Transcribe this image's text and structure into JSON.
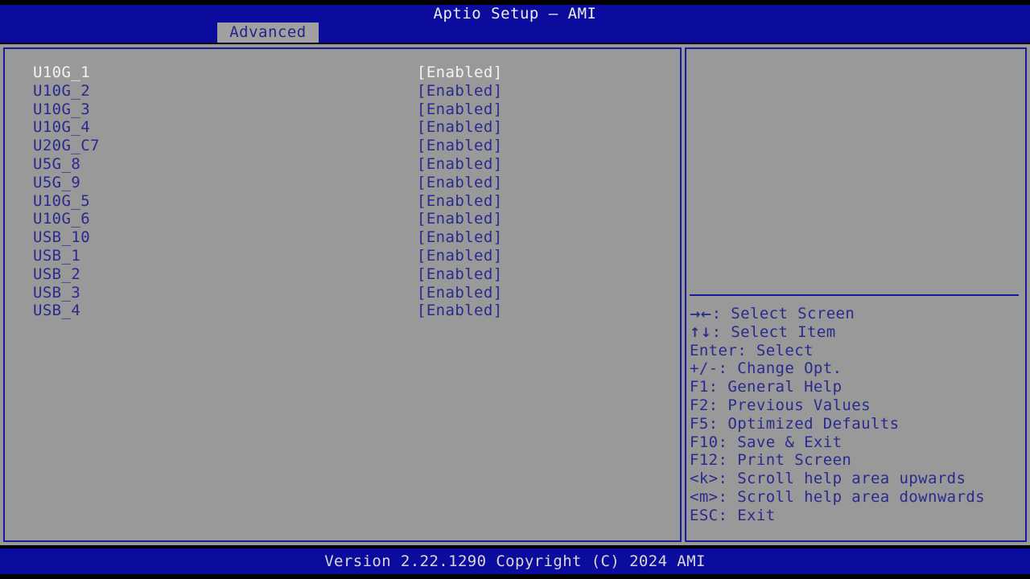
{
  "app": {
    "title": "Aptio Setup – AMI",
    "footer": "Version 2.22.1290 Copyright (C) 2024 AMI"
  },
  "colors": {
    "header_blue": "#0B0B9E",
    "panel_gray": "#999999",
    "text_blue": "#2A2A8E",
    "text_selected": "#F2F2F2",
    "border_blue": "#1A1A9B",
    "tab_gray": "#A0A0A0"
  },
  "tabs": [
    {
      "label": "Advanced",
      "active": true
    }
  ],
  "menu": {
    "selected_index": 0,
    "items": [
      {
        "label": "U10G_1",
        "value": "[Enabled]"
      },
      {
        "label": "U10G_2",
        "value": "[Enabled]"
      },
      {
        "label": "U10G_3",
        "value": "[Enabled]"
      },
      {
        "label": "U10G_4",
        "value": "[Enabled]"
      },
      {
        "label": "U20G_C7",
        "value": "[Enabled]"
      },
      {
        "label": "U5G_8",
        "value": "[Enabled]"
      },
      {
        "label": "U5G_9",
        "value": "[Enabled]"
      },
      {
        "label": "U10G_5",
        "value": "[Enabled]"
      },
      {
        "label": "U10G_6",
        "value": "[Enabled]"
      },
      {
        "label": "USB_10",
        "value": "[Enabled]"
      },
      {
        "label": "USB_1",
        "value": "[Enabled]"
      },
      {
        "label": "USB_2",
        "value": "[Enabled]"
      },
      {
        "label": "USB_3",
        "value": "[Enabled]"
      },
      {
        "label": "USB_4",
        "value": "[Enabled]"
      }
    ]
  },
  "help": {
    "description": "",
    "keys": [
      {
        "glyph": "→←",
        "text": ": Select Screen"
      },
      {
        "glyph": "↑↓",
        "text": ": Select Item"
      },
      {
        "glyph": "",
        "text": "Enter: Select"
      },
      {
        "glyph": "",
        "text": "+/-: Change Opt."
      },
      {
        "glyph": "",
        "text": "F1: General Help"
      },
      {
        "glyph": "",
        "text": "F2: Previous Values"
      },
      {
        "glyph": "",
        "text": "F5: Optimized Defaults"
      },
      {
        "glyph": "",
        "text": "F10: Save & Exit"
      },
      {
        "glyph": "",
        "text": "F12: Print Screen"
      },
      {
        "glyph": "",
        "text": "<k>: Scroll help area upwards"
      },
      {
        "glyph": "",
        "text": "<m>: Scroll help area downwards"
      },
      {
        "glyph": "",
        "text": "ESC: Exit"
      }
    ]
  }
}
